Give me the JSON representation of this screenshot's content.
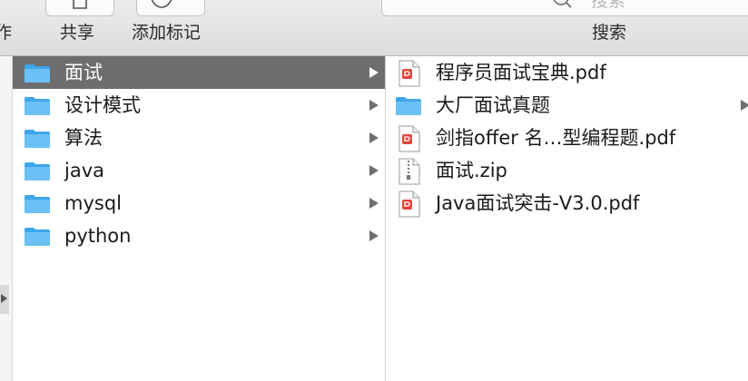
{
  "toolbar": {
    "left_partial_label": "作",
    "share_label": "共享",
    "tags_label": "添加标记",
    "search_label": "搜索",
    "search_placeholder": "搜索"
  },
  "column1": {
    "items": [
      {
        "label": "面试",
        "icon": "folder-icon",
        "selected": true
      },
      {
        "label": "设计模式",
        "icon": "folder-icon"
      },
      {
        "label": "算法",
        "icon": "folder-icon"
      },
      {
        "label": "java",
        "icon": "folder-icon"
      },
      {
        "label": "mysql",
        "icon": "folder-icon"
      },
      {
        "label": "python",
        "icon": "folder-icon"
      }
    ]
  },
  "column2": {
    "items": [
      {
        "label": "程序员面试宝典.pdf",
        "icon": "pdf-icon"
      },
      {
        "label": "大厂面试真题",
        "icon": "folder-icon"
      },
      {
        "label": "剑指offer 名…型编程题.pdf",
        "icon": "pdf-icon"
      },
      {
        "label": "面试.zip",
        "icon": "zip-icon"
      },
      {
        "label": "Java面试突击-V3.0.pdf",
        "icon": "pdf-icon"
      }
    ]
  },
  "colors": {
    "selection": "#6e6e6e",
    "folder": "#6cc0f5",
    "pdf_badge": "#e0463b"
  }
}
